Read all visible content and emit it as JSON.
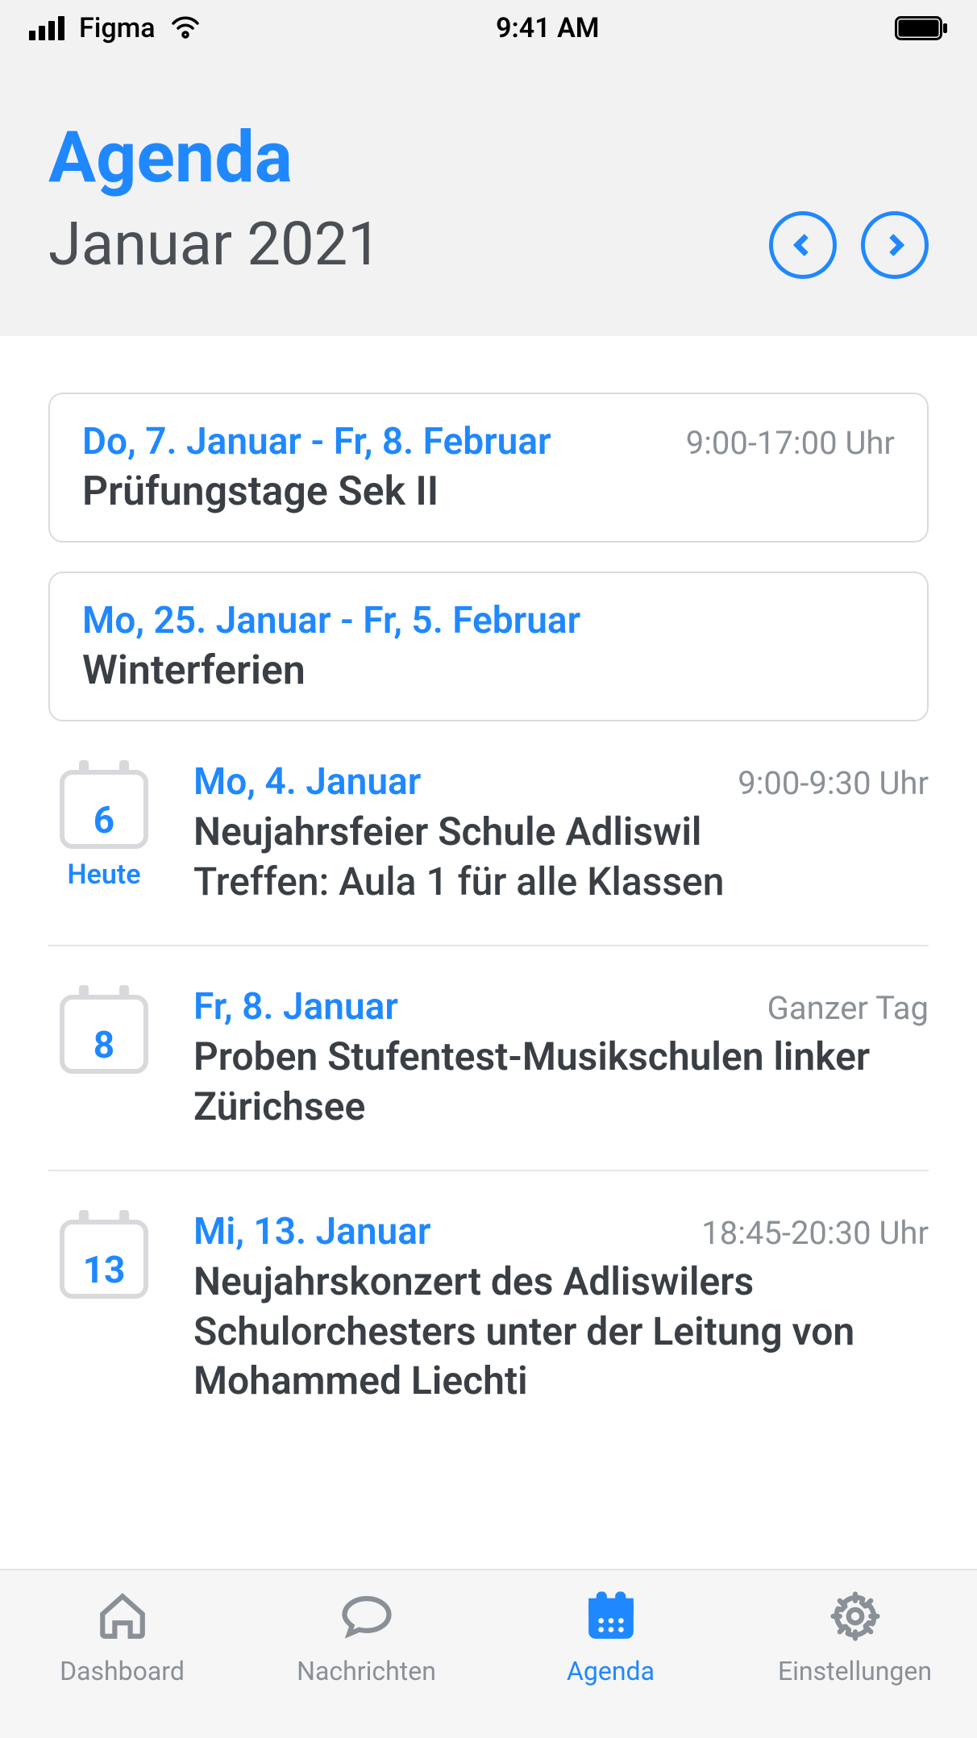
{
  "status_bar": {
    "carrier": "Figma",
    "time": "9:41 AM"
  },
  "header": {
    "title": "Agenda",
    "subtitle": "Januar 2021"
  },
  "banner_events": [
    {
      "date": "Do, 7. Januar - Fr, 8. Februar",
      "time": "9:00-17:00 Uhr",
      "title": "Prüfungstage Sek II"
    },
    {
      "date": "Mo, 25. Januar - Fr, 5. Februar",
      "time": "",
      "title": "Winterferien"
    }
  ],
  "day_events": [
    {
      "day_number": "6",
      "day_label": "Heute",
      "date": "Mo, 4. Januar",
      "time": "9:00-9:30 Uhr",
      "title": "Neujahrsfeier Schule Adliswil",
      "desc": "Treffen: Aula 1 für alle Klassen"
    },
    {
      "day_number": "8",
      "day_label": "",
      "date": "Fr, 8. Januar",
      "time": "Ganzer Tag",
      "title": "Proben Stufentest-Musikschulen linker Zürichsee",
      "desc": ""
    },
    {
      "day_number": "13",
      "day_label": "",
      "date": "Mi, 13. Januar",
      "time": "18:45-20:30 Uhr",
      "title": "Neujahrskonzert des Adliswilers Schulorchesters unter der Leitung von Mohammed Liechti",
      "desc": ""
    }
  ],
  "tabs": {
    "dashboard": "Dashboard",
    "messages": "Nachrichten",
    "agenda": "Agenda",
    "settings": "Einstellungen"
  }
}
